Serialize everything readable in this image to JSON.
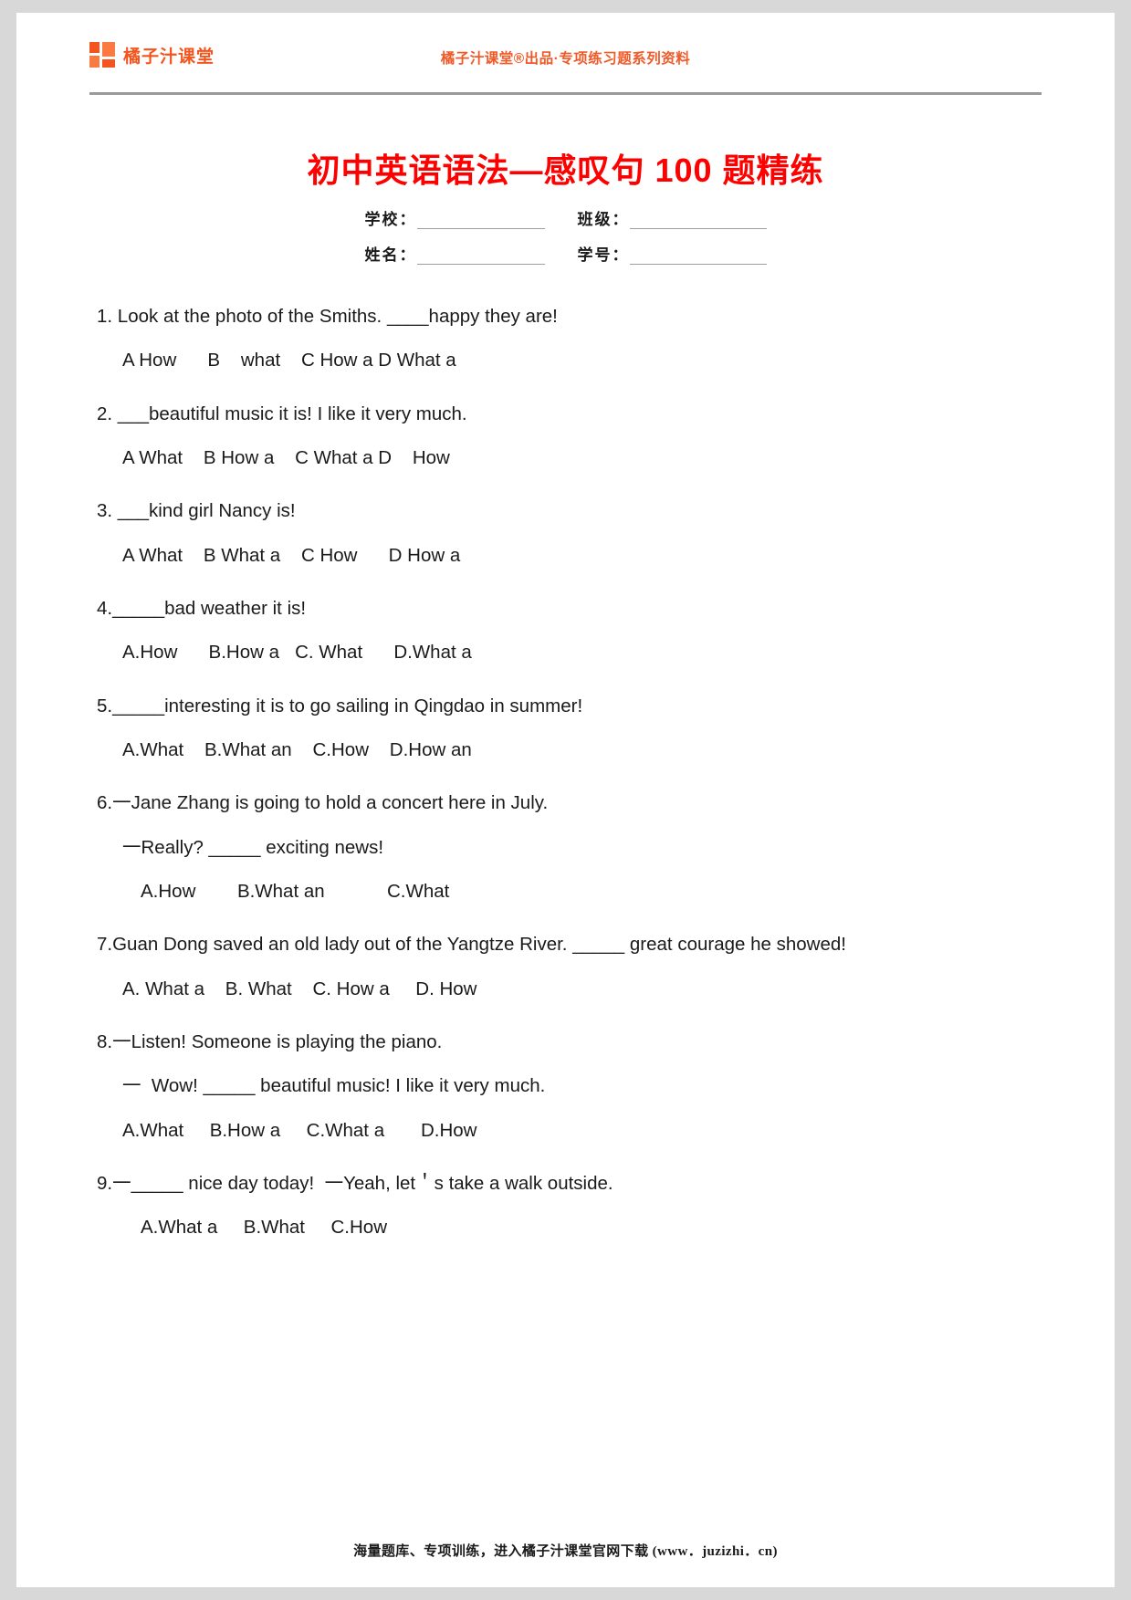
{
  "header": {
    "brand_name": "橘子汁课堂",
    "center_text": "橘子汁课堂®出品·专项练习题系列资料"
  },
  "title": "初中英语语法—感叹句 100 题精练",
  "meta": {
    "school_label": "学校：",
    "class_label": "班级：",
    "name_label": "姓名：",
    "student_id_label": "学号："
  },
  "questions": [
    {
      "stem": "1. Look at the photo of the Smiths. ____happy they are!",
      "options": "A How      B    what    C How a D What a"
    },
    {
      "stem": "2. ___beautiful music it is! I like it very much.",
      "options": "A What    B How a    C What a D    How"
    },
    {
      "stem": "3. ___kind girl Nancy is!",
      "options": "A What    B What a    C How      D How a"
    },
    {
      "stem": "4._____bad weather it is!",
      "options": "A.How      B.How a   C. What      D.What a"
    },
    {
      "stem": "5._____interesting it is to go sailing in Qingdao in summer!",
      "options": "A.What    B.What an    C.How    D.How an"
    },
    {
      "stem": "6.一Jane Zhang is going to hold a concert here in July.",
      "dialog": "一Really? _____ exciting news!",
      "options": "A.How        B.What an            C.What"
    },
    {
      "stem": "7.Guan Dong saved an old lady out of the Yangtze River. _____ great courage he showed!",
      "options": "A. What a    B. What    C. How a     D. How"
    },
    {
      "stem": "8.一Listen! Someone is playing the piano.",
      "dialog": "一  Wow! _____ beautiful music! I like it very much.",
      "options": "A.What     B.How a     C.What a       D.How"
    },
    {
      "stem": "9.一_____ nice day today!  一Yeah, let＇s take a walk outside.",
      "options": "A.What a     B.What     C.How"
    }
  ],
  "footer": "海量题库、专项训练，进入橘子汁课堂官网下载 (www．juzizhi．cn)"
}
